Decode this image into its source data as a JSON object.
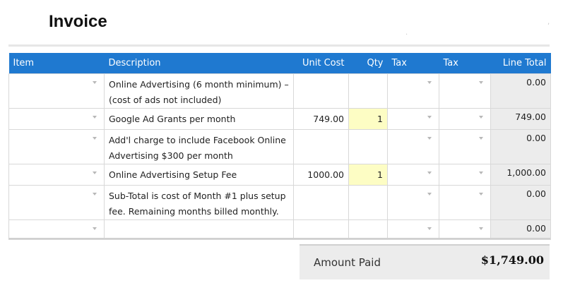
{
  "invoice": {
    "title": "Invoice",
    "columns": {
      "item": "Item",
      "description": "Description",
      "unit_cost": "Unit Cost",
      "qty": "Qty",
      "tax1": "Tax",
      "tax2": "Tax",
      "line_total": "Line Total"
    },
    "rows": [
      {
        "desc1": "Online Advertising (6 month minimum) –",
        "desc2": "(cost of ads not included)",
        "unit_cost": "",
        "qty": "",
        "line_total": "0.00"
      },
      {
        "desc1": "Google Ad Grants per month",
        "desc2": "",
        "unit_cost": "749.00",
        "qty": "1",
        "line_total": "749.00"
      },
      {
        "desc1": "Add'l charge to include Facebook Online",
        "desc2": "Advertising $300 per month",
        "unit_cost": "",
        "qty": "",
        "line_total": "0.00"
      },
      {
        "desc1": "Online Advertising Setup Fee",
        "desc2": "",
        "unit_cost": "1000.00",
        "qty": "1",
        "line_total": "1,000.00"
      },
      {
        "desc1": "Sub-Total is cost of Month #1 plus setup",
        "desc2": "fee. Remaining months billed monthly.",
        "unit_cost": "",
        "qty": "",
        "line_total": "0.00"
      },
      {
        "desc1": "",
        "desc2": "",
        "unit_cost": "",
        "qty": "",
        "line_total": "0.00"
      }
    ],
    "amount_paid_label": "Amount Paid",
    "amount_paid_value": "$1,749.00",
    "icons": {
      "dropdown": "chevron-down-icon"
    },
    "colors": {
      "header": "#1f79d0",
      "qty_highlight": "#fdfdc4",
      "total_bg": "#ececec"
    }
  }
}
